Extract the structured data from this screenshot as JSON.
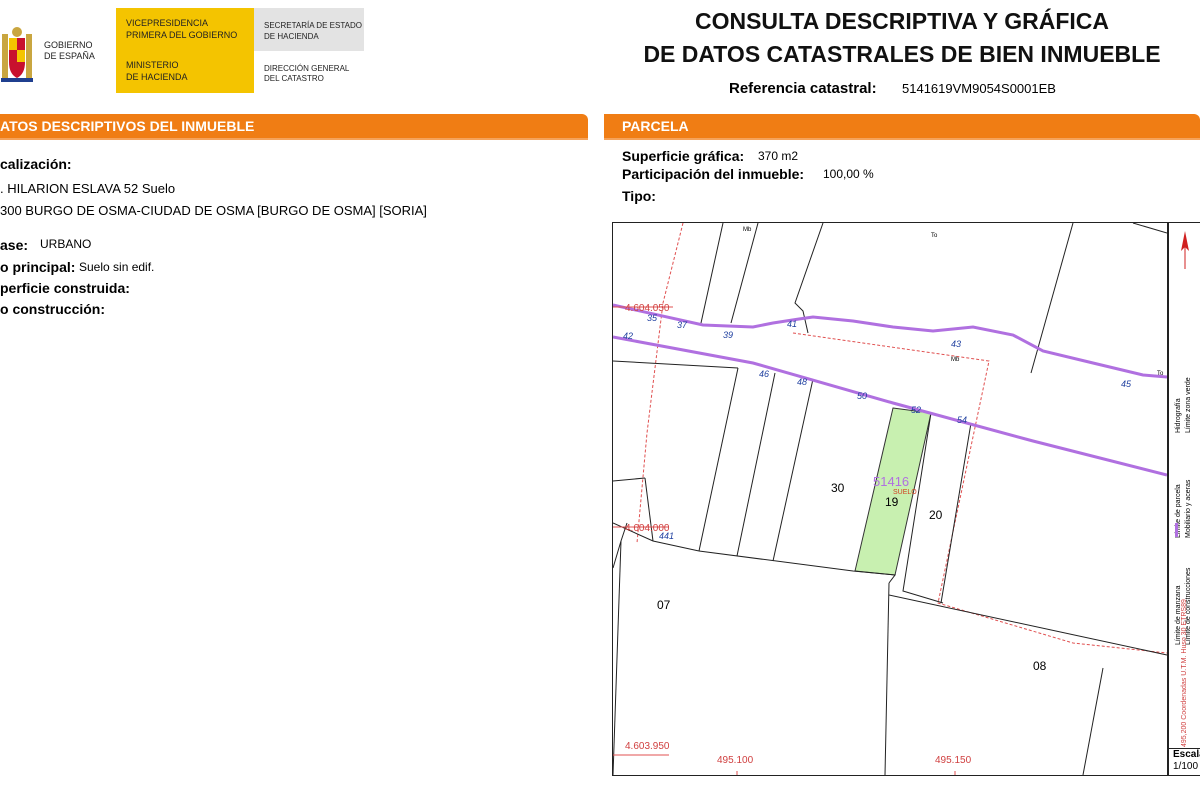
{
  "header": {
    "gov_line1": "GOBIERNO",
    "gov_line2": "DE ESPAÑA",
    "vp_line1": "VICEPRESIDENCIA",
    "vp_line2": "PRIMERA DEL GOBIERNO",
    "min_line1": "MINISTERIO",
    "min_line2": "DE HACIENDA",
    "sec_line1": "SECRETARÍA DE ESTADO",
    "sec_line2": "DE HACIENDA",
    "dir_line1": "DIRECCIÓN GENERAL",
    "dir_line2": "DEL CATASTRO",
    "title_line1": "CONSULTA DESCRIPTIVA Y GRÁFICA",
    "title_line2": "DE DATOS CATASTRALES DE BIEN INMUEBLE",
    "ref_label": "Referencia catastral:",
    "ref_value": "5141619VM9054S0001EB"
  },
  "descriptivos": {
    "section_prefix": "ATOS DESCRIPTIVOS DEL ",
    "section_bold": "INMUEBLE",
    "localizacion_label": "calización:",
    "address_line1": ". HILARION ESLAVA 52 Suelo",
    "address_line2": "300 BURGO DE OSMA-CIUDAD DE OSMA [BURGO DE OSMA] [SORIA]",
    "clase_label": "ase:",
    "clase_value": "URBANO",
    "uso_label": "o principal:",
    "uso_value": "Suelo sin edif.",
    "superficie_label": "perficie construida:",
    "anio_label": "o construcción:"
  },
  "parcela": {
    "section_title": "PARCELA",
    "sup_label": "Superficie gráfica:",
    "sup_value": "370 m2",
    "part_label": "Participación del inmueble:",
    "part_value": "100,00 %",
    "tipo_label": "Tipo:"
  },
  "map": {
    "parcel_numbers": {
      "p30": "30",
      "p19": "19",
      "p20": "20",
      "p07": "07",
      "p08": "08"
    },
    "block_id": "51416",
    "suelo_tag": "SUELO",
    "coords": {
      "y1": "4.604.050",
      "y2": "4.604.000",
      "y3": "4.603.950",
      "x1": "495.100",
      "x2": "495.150"
    },
    "street_numbers": [
      "35",
      "37",
      "39",
      "41",
      "43",
      "42",
      "46",
      "48",
      "50",
      "52",
      "54",
      "45",
      "441"
    ],
    "small_labels": {
      "mb1": "Mb",
      "mb2": "Mb",
      "to1": "To",
      "to2": "To"
    },
    "colors": {
      "parcel_fill": "#c8f0b0",
      "manzana": "#b070e0",
      "parcel_line": "#e05050"
    }
  },
  "legend": {
    "item1": "Límite de manzana",
    "item2": "Límite de construcciones",
    "item3": "Límite de parcela",
    "item4": "Mobiliario y aceras",
    "item5": "Hidrografía",
    "item6": "Límite zona verde",
    "coords_note": "495,200 Coordenadas U.T.M. Huso 30 ETRS89",
    "scale_label": "Escala",
    "scale_value": "1/100"
  }
}
